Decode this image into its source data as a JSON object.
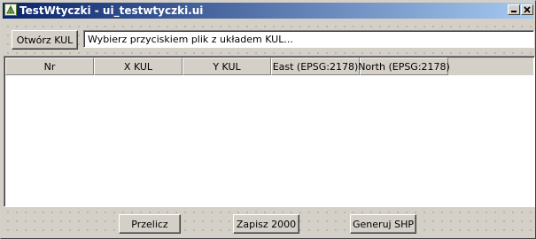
{
  "window": {
    "title": "TestWtyczki - ui_testwtyczki.ui",
    "icons": {
      "app": "qgis-leaf-icon",
      "minimize": "minimize-icon",
      "close": "close-icon"
    }
  },
  "toolbar": {
    "open_button": "Otwórz KUL",
    "file_field_value": "Wybierz przyciskiem plik z układem KUL..."
  },
  "table": {
    "columns": [
      "Nr",
      "X KUL",
      "Y KUL",
      "East (EPSG:2178)",
      "North (EPSG:2178)"
    ],
    "rows": []
  },
  "actions": {
    "calculate": "Przelicz",
    "save_2000": "Zapisz 2000",
    "generate_shp": "Generuj SHP"
  }
}
